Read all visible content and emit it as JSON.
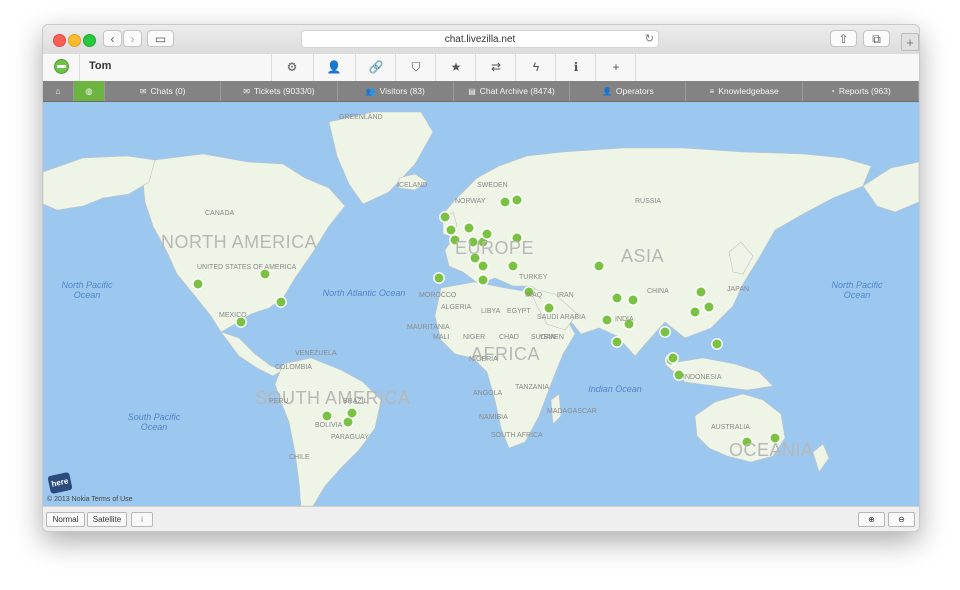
{
  "browser": {
    "url": "chat.livezilla.net",
    "back_icon": "chevron-left-icon",
    "forward_icon": "chevron-right-icon",
    "reload_icon": "reload-icon",
    "back_glyph": "‹",
    "forward_glyph": "›",
    "reload_glyph": "↻",
    "sidebar_glyph": "▭",
    "share_glyph": "⇧",
    "tabs_glyph": "⧉",
    "newtab_glyph": "+"
  },
  "toolbar": {
    "user": "Tom",
    "icons": [
      {
        "name": "settings-gears-icon",
        "glyph": "⚙"
      },
      {
        "name": "user-icon",
        "glyph": "👤"
      },
      {
        "name": "link-icon",
        "glyph": "🔗"
      },
      {
        "name": "shield-icon",
        "glyph": "⛉"
      },
      {
        "name": "star-icon",
        "glyph": "★"
      },
      {
        "name": "translate-icon",
        "glyph": "⇄"
      },
      {
        "name": "lightning-icon",
        "glyph": "ϟ"
      },
      {
        "name": "info-icon",
        "glyph": "ℹ"
      },
      {
        "name": "plus-icon",
        "glyph": "+"
      }
    ]
  },
  "nav": {
    "home_icon": "⌂",
    "globe_icon": "◍",
    "items": [
      {
        "label": "Chats (0)",
        "icon": "chat-icon",
        "glyph": "✉"
      },
      {
        "label": "Tickets (9033/0)",
        "icon": "envelope-icon",
        "glyph": "✉"
      },
      {
        "label": "Visitors (83)",
        "icon": "users-icon",
        "glyph": "👥"
      },
      {
        "label": "Chat Archive (8474)",
        "icon": "archive-icon",
        "glyph": "▤"
      },
      {
        "label": "Operators",
        "icon": "operator-icon",
        "glyph": "👤"
      },
      {
        "label": "Knowledgebase",
        "icon": "database-icon",
        "glyph": "≡"
      },
      {
        "label": "Reports (963)",
        "icon": "pie-chart-icon",
        "glyph": "◔"
      }
    ]
  },
  "map": {
    "ocean_color": "#9cc8f0",
    "land_color": "#eef5e6",
    "marker_color": "#7cc242",
    "continents": [
      "NORTH AMERICA",
      "SOUTH AMERICA",
      "EUROPE",
      "ASIA",
      "AFRICA",
      "OCEANIA"
    ],
    "oceans": [
      "North Pacific Ocean",
      "North Atlantic Ocean",
      "South Pacific Ocean",
      "Indian Ocean",
      "North Pacific Ocean"
    ],
    "countries": [
      "GREENLAND",
      "ICELAND",
      "CANADA",
      "UNITED STATES OF AMERICA",
      "MEXICO",
      "VENEZUELA",
      "COLOMBIA",
      "PERU",
      "BRAZIL",
      "BOLIVIA",
      "PARAGUAY",
      "CHILE",
      "SWEDEN",
      "NORWAY",
      "RUSSIA",
      "MOROCCO",
      "ALGERIA",
      "LIBYA",
      "EGYPT",
      "MAURITANIA",
      "MALI",
      "NIGER",
      "CHAD",
      "SUDAN",
      "NIGERIA",
      "TURKEY",
      "IRAQ",
      "IRAN",
      "SAUDI ARABIA",
      "YEMEN",
      "CHINA",
      "INDIA",
      "JAPAN",
      "INDONESIA",
      "TANZANIA",
      "ANGOLA",
      "NAMIBIA",
      "SOUTH AFRICA",
      "MADAGASCAR",
      "AUSTRALIA"
    ],
    "copyright": "© 2013 Nokia Terms of Use",
    "here_logo": "here"
  },
  "bottombar": {
    "normal_label": "Normal",
    "satellite_label": "Satellite",
    "info_glyph": "i",
    "zoom_in_glyph": "⊕",
    "zoom_out_glyph": "⊖"
  }
}
